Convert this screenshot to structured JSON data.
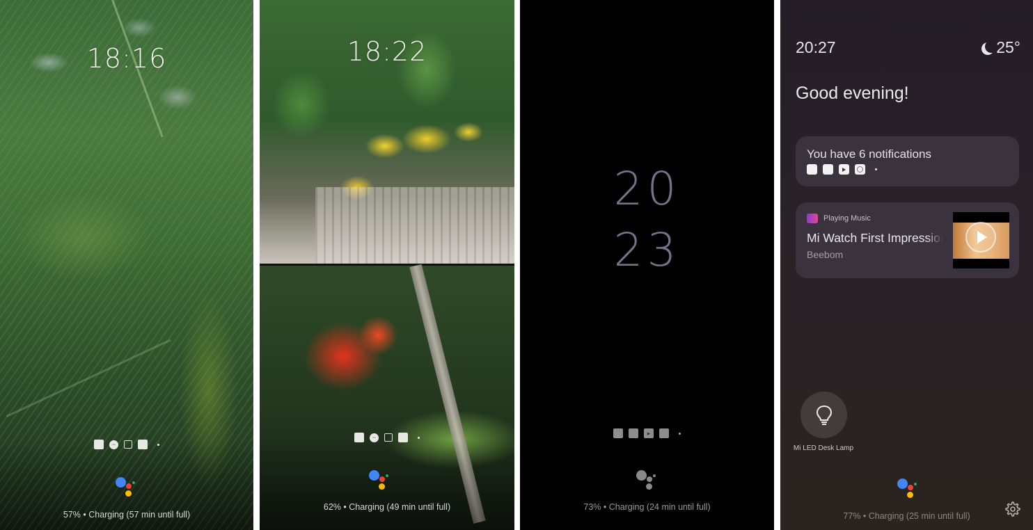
{
  "panels": [
    {
      "id": "fern-wallpaper",
      "clock": "18:16",
      "notification_icons": [
        "app-icon",
        "messenger-icon",
        "screenshot-icon",
        "app-icon",
        "more-dot"
      ],
      "charging_status": "57% • Charging (57 min until full)",
      "assistant_style": "color"
    },
    {
      "id": "flowers-wallpaper",
      "clock": "18:22",
      "notification_icons": [
        "app-icon",
        "messenger-icon",
        "screenshot-icon",
        "app-icon",
        "more-dot"
      ],
      "charging_status": "62% • Charging (49 min until full)",
      "assistant_style": "color"
    },
    {
      "id": "dark-clock",
      "clock_line1": "20",
      "clock_line2": "23",
      "notification_icons": [
        "app-icon",
        "photo-icon",
        "youtube-icon",
        "app-icon",
        "more-dot"
      ],
      "charging_status": "73% • Charging (24 min until full)",
      "assistant_style": "mono"
    },
    {
      "id": "ambient-hub",
      "time": "20:27",
      "weather_icon": "moon-icon",
      "temperature": "25°",
      "greeting": "Good evening!",
      "notifications_card": {
        "title": "You have 6 notifications",
        "icons": [
          "app-icon",
          "app-icon",
          "youtube-icon",
          "circle-app-icon",
          "more-dot"
        ]
      },
      "media_card": {
        "app_label": "Playing Music",
        "track_title": "Mi Watch First Impressions",
        "artist": "Beebom",
        "thumbnail_icon": "play-icon"
      },
      "device_control": {
        "label": "Mi LED Desk Lamp",
        "icon": "lightbulb-icon"
      },
      "charging_status": "77% • Charging (25 min until full)",
      "settings_icon": "gear-icon"
    }
  ],
  "colors": {
    "assistant_blue": "#4285f4",
    "assistant_red": "#ea4335",
    "assistant_yellow": "#fbbc05",
    "assistant_green": "#34a853",
    "year_clock": "#77728a",
    "hub_card_bg": "#3a323c"
  }
}
